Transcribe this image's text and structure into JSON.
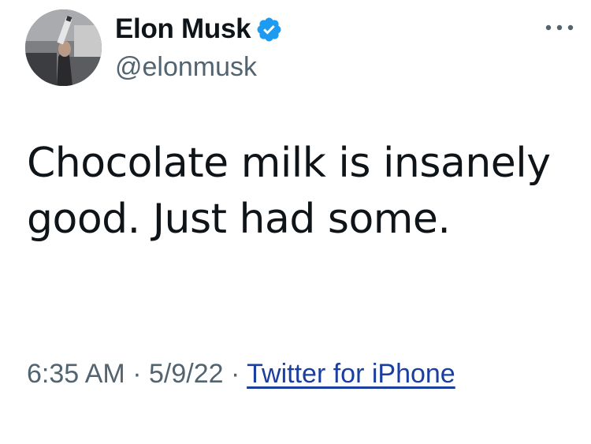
{
  "user": {
    "display_name": "Elon Musk",
    "handle": "@elonmusk",
    "verified": true
  },
  "tweet": {
    "text": "Chocolate milk is insanely good. Just had some.",
    "time": "6:35 AM",
    "separator": "·",
    "date": "5/9/22",
    "source": "Twitter for iPhone"
  },
  "icons": {
    "verified": "verified-badge-icon",
    "more": "more-options-icon"
  },
  "colors": {
    "text": "#0f1419",
    "secondary": "#536471",
    "link": "#1b3fa0",
    "verified": "#1d9bf0",
    "background": "#ffffff"
  }
}
